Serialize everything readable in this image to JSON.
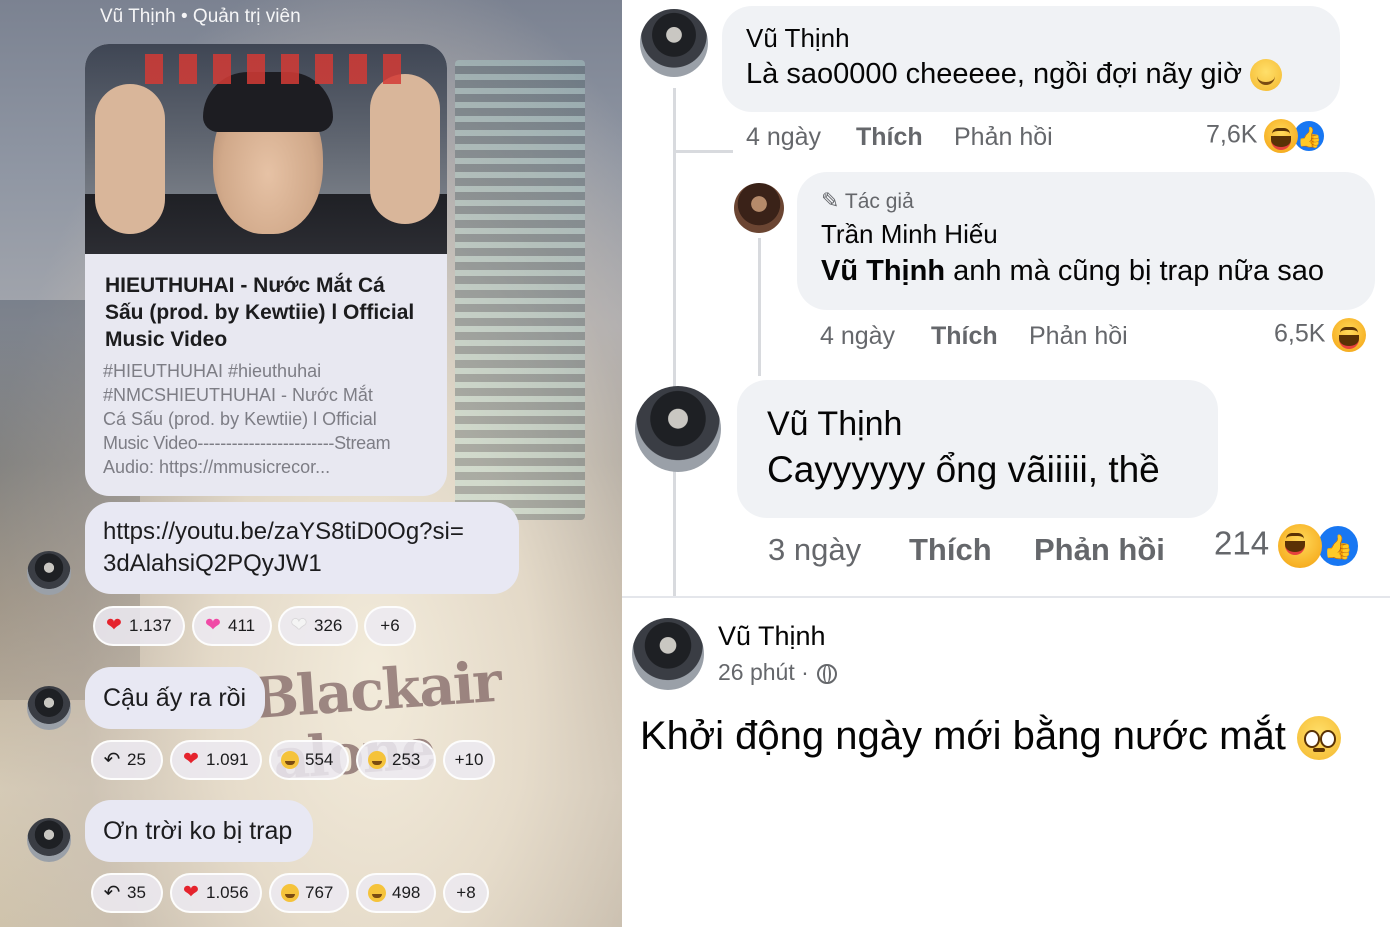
{
  "left": {
    "admin_label": "Vũ Thịnh • Quản trị viên",
    "link_card": {
      "title": "HIEUTHUHAI - Nước Mắt Cá Sấu (prod. by Kewtiie) l Official Music Video",
      "desc_lines": [
        "#HIEUTHUHAI #hieuthuhai",
        "#NMCSHIEUTHUHAI - Nước Mắt",
        "Cá Sấu (prod. by Kewtiie) l Official",
        "Music Video------------------------Stream",
        "Audio: https://mmusicrecor..."
      ]
    },
    "url_message": {
      "line1": "https://youtu.be/zaYS8tiD0Og?si=",
      "line2": "3dAlahsiQ2PQyJW1"
    },
    "url_reactions": [
      {
        "icon": "red-heart-icon",
        "count": "1.137"
      },
      {
        "icon": "pink-heart-icon",
        "count": "411"
      },
      {
        "icon": "white-heart-icon",
        "count": "326"
      },
      {
        "icon": "",
        "count": "+6"
      }
    ],
    "message2": {
      "text": "Cậu ấy ra rồi",
      "replies": "25",
      "reactions": [
        {
          "icon": "red-heart-icon",
          "count": "1.091"
        },
        {
          "icon": "laugh-emoji-icon",
          "count": "554"
        },
        {
          "icon": "grin-emoji-icon",
          "count": "253"
        },
        {
          "icon": "",
          "count": "+10"
        }
      ]
    },
    "message3": {
      "text": "Ơn trời ko bị trap",
      "replies": "35",
      "reactions": [
        {
          "icon": "red-heart-icon",
          "count": "1.056"
        },
        {
          "icon": "laugh-emoji-icon",
          "count": "767"
        },
        {
          "icon": "grin-emoji-icon",
          "count": "498"
        },
        {
          "icon": "",
          "count": "+8"
        }
      ]
    }
  },
  "right": {
    "comment1": {
      "author": "Vũ Thịnh",
      "text": "Là sao0000 cheeeee, ngồi đợi nãy giờ",
      "time": "4 ngày",
      "like": "Thích",
      "reply": "Phản hồi",
      "reaction_count": "7,6K"
    },
    "reply1": {
      "badge": "Tác giả",
      "author": "Trần Minh Hiếu",
      "mention": "Vũ Thịnh",
      "text": " anh mà cũng bị trap nữa sao",
      "time": "4 ngày",
      "like": "Thích",
      "reply": "Phản hồi",
      "reaction_count": "6,5K"
    },
    "comment2": {
      "author": "Vũ Thịnh",
      "text": "Cayyyyyy ổng vãiiiii, thề",
      "time": "3 ngày",
      "like": "Thích",
      "reply": "Phản hồi",
      "reaction_count": "214"
    },
    "post": {
      "author": "Vũ Thịnh",
      "time": "26 phút ·",
      "text": "Khởi động ngày mới bằng nước mắt"
    }
  }
}
